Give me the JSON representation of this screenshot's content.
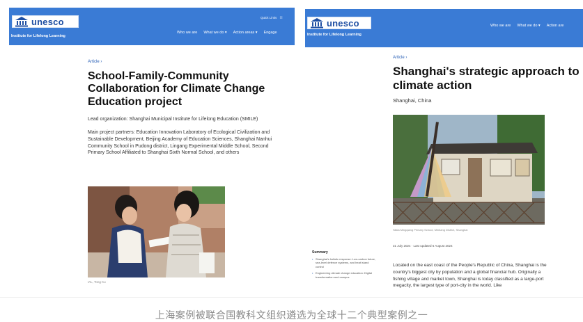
{
  "left": {
    "logo_text": "unesco",
    "bar_subtitle": "Institute for Lifelong Learning",
    "quick_links": "Quick Links",
    "nav": [
      "Who we are",
      "What we do ▾",
      "Action areas ▾",
      "Engage"
    ],
    "breadcrumb": "Article  ›",
    "title": "School-Family-Community Collaboration for Climate Change Education project",
    "lead": "Lead organization: Shanghai Municipal Institute for Lifelong Education (SMILE)",
    "partners": "Main project partners: Education Innovation Laboratory of Ecological Civilization and Sustainable Development, Beijing Academy of Education Sciences, Shanghai Nanhui Community School in Pudong district, Lingang Experimental Middle School, Second Primary School Affiliated to Shanghai Sixth Normal School, and others",
    "photo_caption": "IAL, Tong Ku"
  },
  "right": {
    "logo_text": "unesco",
    "bar_subtitle": "Institute for Lifelong Learning",
    "nav": [
      "Who we are",
      "What we do ▾",
      "Action are"
    ],
    "breadcrumb": "Article  ›",
    "title": "Shanghai's strategic approach to climate action",
    "location": "Shanghai, China",
    "photo_caption": "Silkia Mingqiang Primary School, Minhang District, Shanghai",
    "date_line": "31 July 2024 · Last updated 6 August 2024",
    "summary_title": "Summary",
    "summary_items": [
      "Shanghai's holistic response: Low-carbon future, sea-level defence systems, and heat island control",
      "Engineering climate change education: Digital transformation and campus"
    ],
    "body": "Located on the east coast of the People's Republic of China, Shanghai is the country's biggest city by population and a global financial hub. Originally a fishing village and market town, Shanghai is today classified as a large-port megacity, the largest type of port-city in the world. Like"
  },
  "caption": "上海案例被联合国教科文组织遴选为全球十二个典型案例之一",
  "colors": {
    "bar": "#3a7bd5",
    "logo_text": "#1f4fa3",
    "link": "#2b61b7"
  }
}
